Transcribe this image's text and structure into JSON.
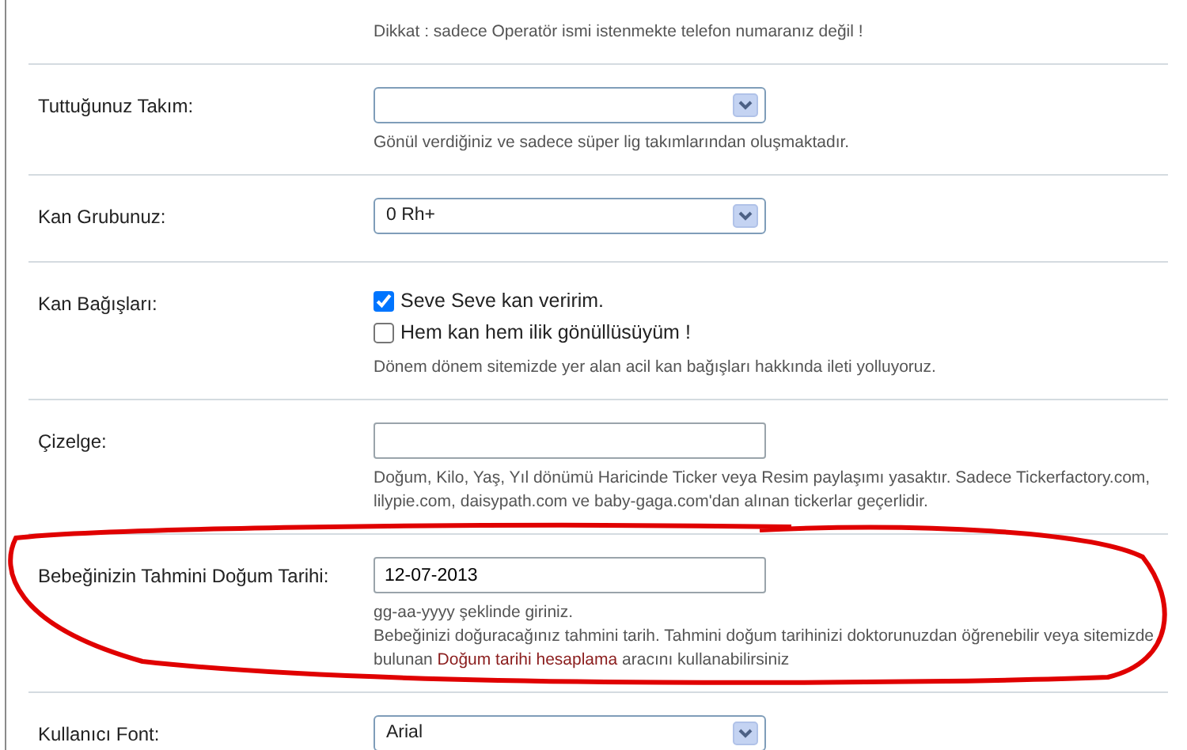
{
  "rows": [
    {
      "kind": "note",
      "label": "",
      "hints": [
        {
          "text": "Dikkat : sadece Operatör ismi istenmekte telefon numaranız değil !"
        }
      ]
    },
    {
      "kind": "select",
      "label": "Tuttuğunuz Takım:",
      "value": "",
      "hints": [
        {
          "text": "Gönül verdiğiniz ve sadece süper lig takımlarından oluşmaktadır."
        }
      ]
    },
    {
      "kind": "select",
      "label": "Kan Grubunuz:",
      "value": "0 Rh+"
    },
    {
      "kind": "checkboxes",
      "label": "Kan Bağışları:",
      "options": [
        {
          "text": "Seve Seve kan veririm.",
          "checked": true
        },
        {
          "text": "Hem kan hem ilik gönüllüsüyüm !",
          "checked": false
        }
      ],
      "hints": [
        {
          "text": "Dönem dönem sitemizde yer alan acil kan bağışları hakkında ileti yolluyoruz."
        }
      ]
    },
    {
      "kind": "text",
      "label": "Çizelge:",
      "value": "",
      "hints": [
        {
          "text": "Doğum, Kilo, Yaş, Yıl dönümü Haricinde Ticker veya Resim paylaşımı yasaktır. Sadece Tickerfactory.com, lilypie.com, daisypath.com ve baby-gaga.com'dan alınan tickerlar geçerlidir."
        }
      ]
    },
    {
      "kind": "text",
      "label": "Bebeğinizin Tahmini Doğum Tarihi:",
      "value": "12-07-2013",
      "hints": [
        {
          "text": "gg-aa-yyyy şeklinde giriniz."
        },
        {
          "text": "Bebeğinizi doğuracağınız tahmini tarih. Tahmini doğum tarihinizi doktorunuzdan öğrenebilir veya sitemizde bulunan",
          "link": "Doğum tarihi hesaplama",
          "after": "aracını kullanabilirsiniz"
        }
      ]
    },
    {
      "kind": "select",
      "label": "Kullanıcı Font:",
      "value": "Arial"
    }
  ]
}
